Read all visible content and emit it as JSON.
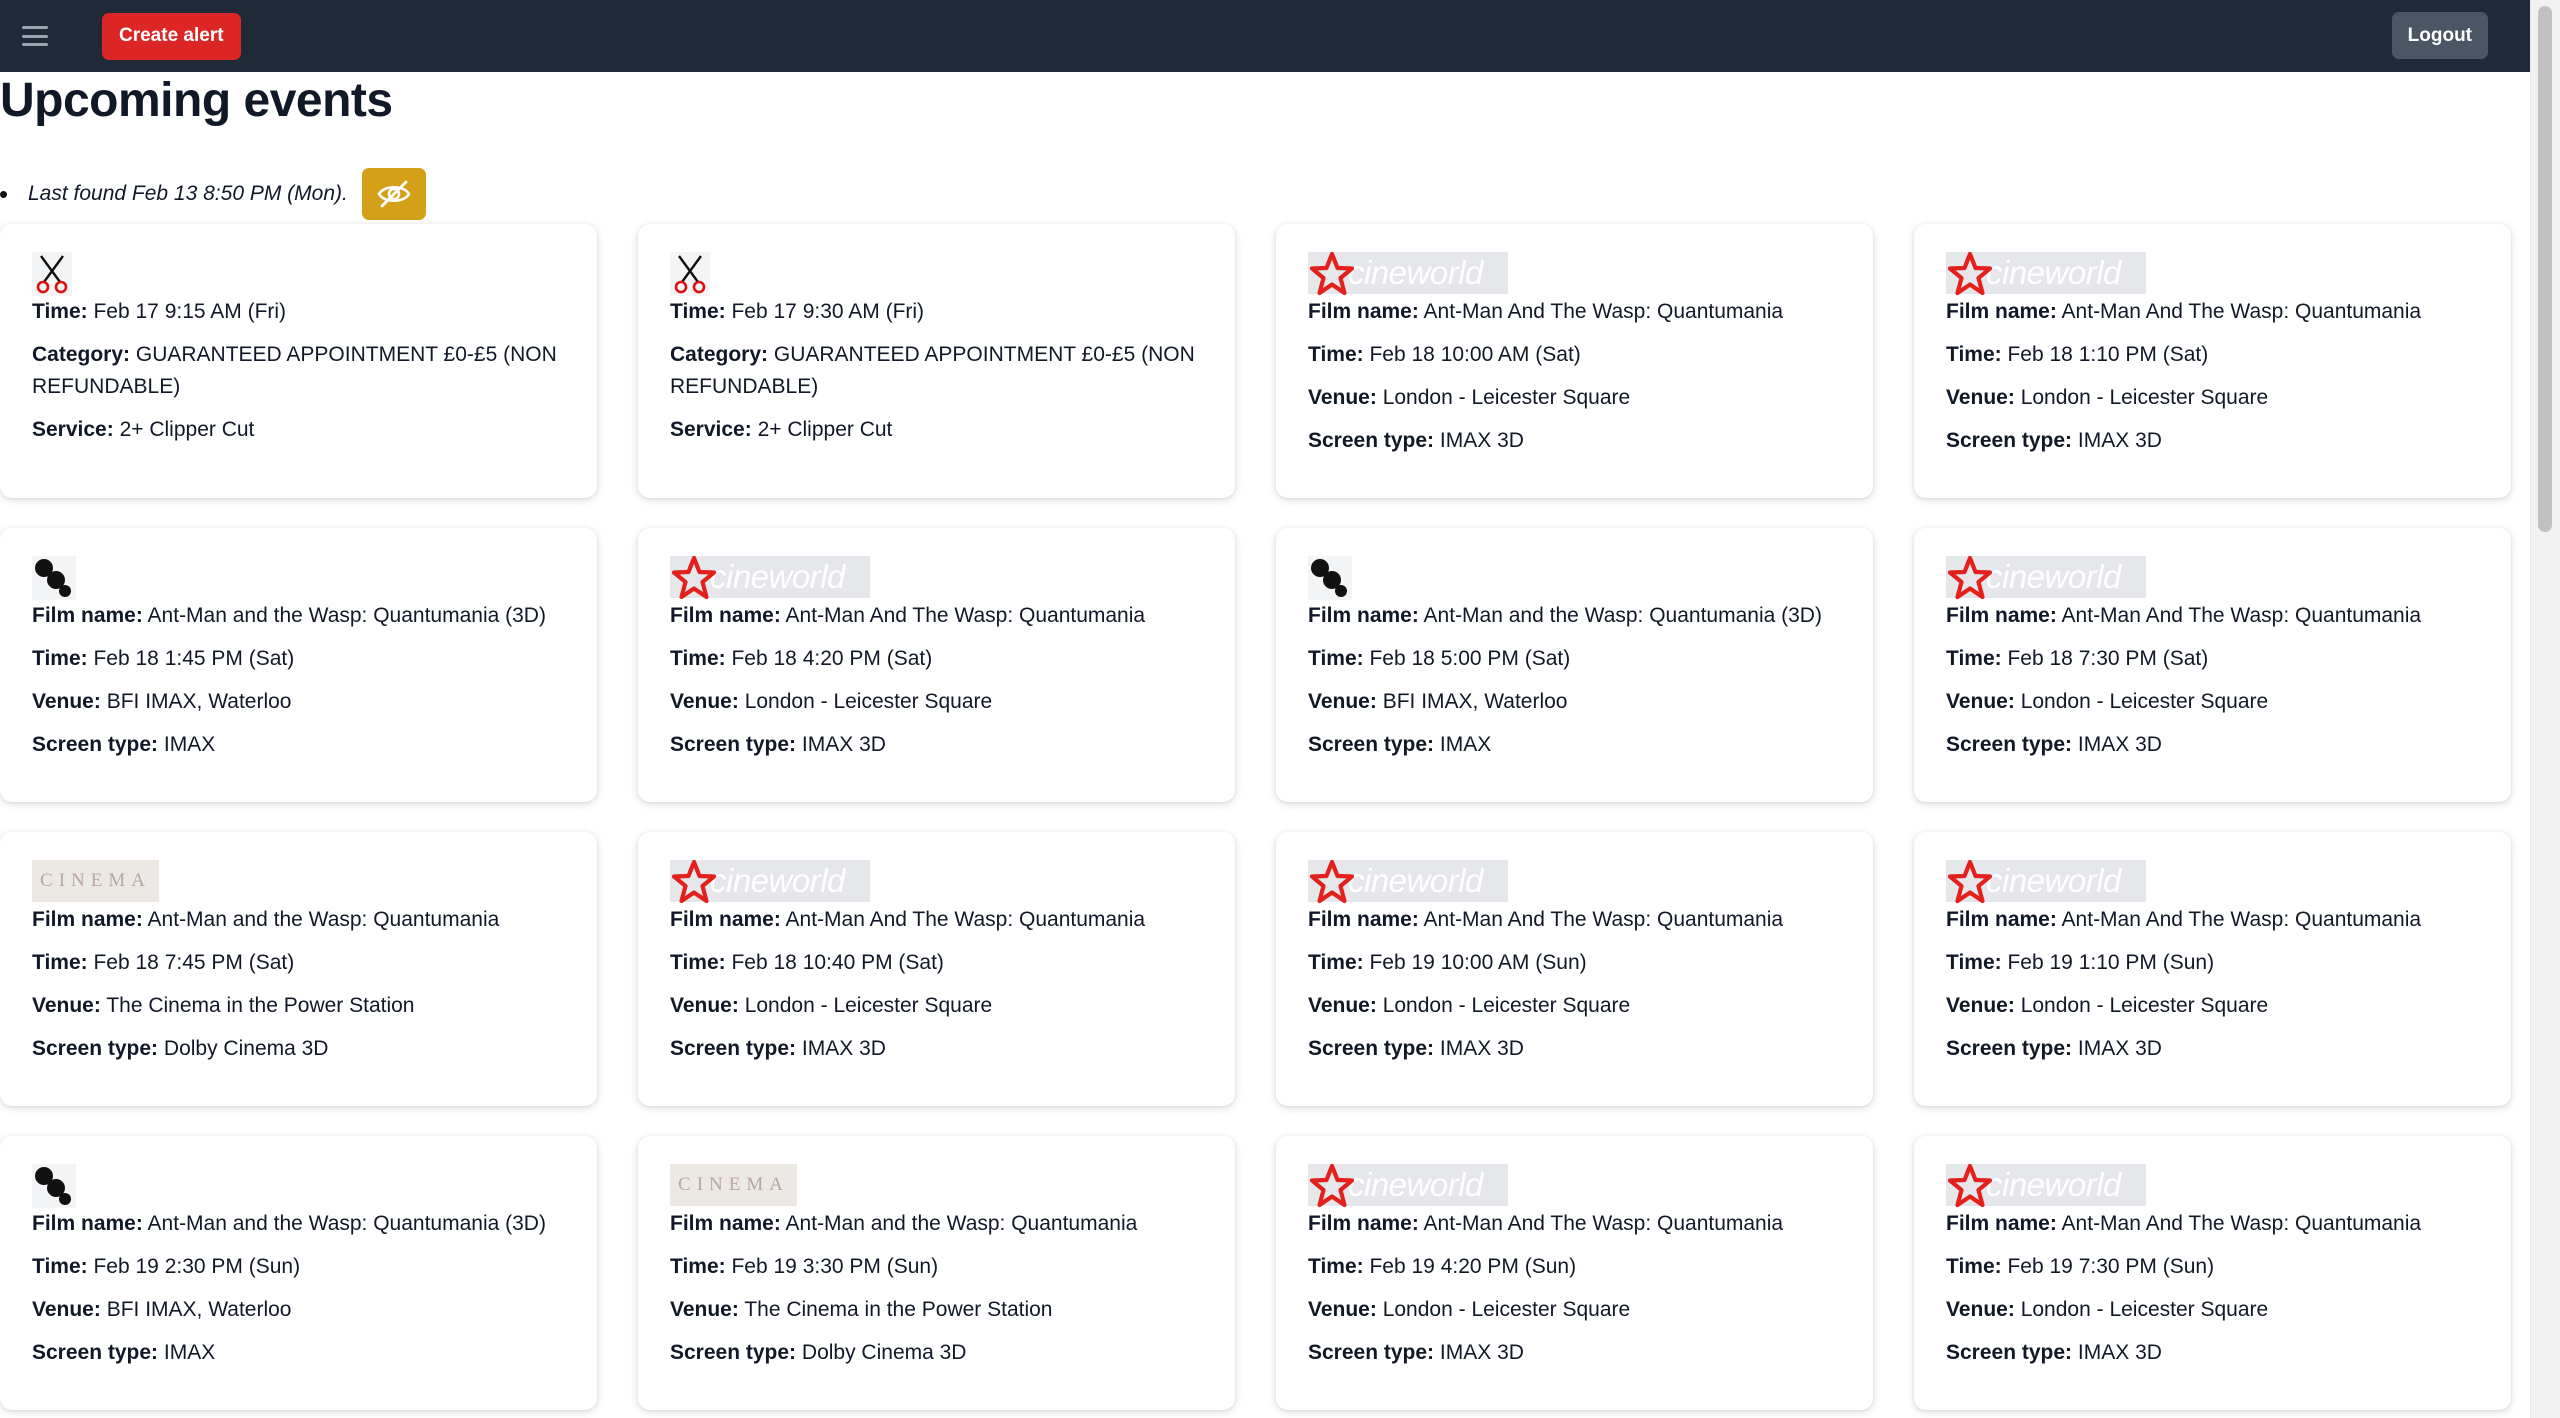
{
  "header": {
    "create_alert_label": "Create alert",
    "logout_label": "Logout"
  },
  "page": {
    "title": "Upcoming events",
    "status": "Last found Feb 13 8:50 PM (Mon)."
  },
  "colors": {
    "topbar": "#1f2937",
    "create_alert": "#dc2626",
    "logout": "#4b5563",
    "hide_toggle": "#d4a017",
    "cineworld_star": "#e3211c"
  },
  "logo_text": {
    "cineworld": "cineworld",
    "cinema": "CINEMA"
  },
  "events": [
    {
      "logo": "scissors-icon",
      "fields": [
        {
          "label": "Time:",
          "value": "Feb 17 9:15 AM (Fri)"
        },
        {
          "label": "Category:",
          "value": "GUARANTEED APPOINTMENT £0-£5 (NON REFUNDABLE)"
        },
        {
          "label": "Service:",
          "value": "2+ Clipper Cut"
        }
      ]
    },
    {
      "logo": "scissors-icon",
      "fields": [
        {
          "label": "Time:",
          "value": "Feb 17 9:30 AM (Fri)"
        },
        {
          "label": "Category:",
          "value": "GUARANTEED APPOINTMENT £0-£5 (NON REFUNDABLE)"
        },
        {
          "label": "Service:",
          "value": "2+ Clipper Cut"
        }
      ]
    },
    {
      "logo": "cineworld-logo",
      "fields": [
        {
          "label": "Film name:",
          "value": "Ant-Man And The Wasp: Quantumania"
        },
        {
          "label": "Time:",
          "value": "Feb 18 10:00 AM (Sat)"
        },
        {
          "label": "Venue:",
          "value": "London - Leicester Square"
        },
        {
          "label": "Screen type:",
          "value": "IMAX 3D"
        }
      ]
    },
    {
      "logo": "cineworld-logo",
      "fields": [
        {
          "label": "Film name:",
          "value": "Ant-Man And The Wasp: Quantumania"
        },
        {
          "label": "Time:",
          "value": "Feb 18 1:10 PM (Sat)"
        },
        {
          "label": "Venue:",
          "value": "London - Leicester Square"
        },
        {
          "label": "Screen type:",
          "value": "IMAX 3D"
        }
      ]
    },
    {
      "logo": "bfi-logo",
      "fields": [
        {
          "label": "Film name:",
          "value": "Ant-Man and the Wasp: Quantumania (3D)"
        },
        {
          "label": "Time:",
          "value": "Feb 18 1:45 PM (Sat)"
        },
        {
          "label": "Venue:",
          "value": "BFI IMAX, Waterloo"
        },
        {
          "label": "Screen type:",
          "value": "IMAX"
        }
      ]
    },
    {
      "logo": "cineworld-logo",
      "fields": [
        {
          "label": "Film name:",
          "value": "Ant-Man And The Wasp: Quantumania"
        },
        {
          "label": "Time:",
          "value": "Feb 18 4:20 PM (Sat)"
        },
        {
          "label": "Venue:",
          "value": "London - Leicester Square"
        },
        {
          "label": "Screen type:",
          "value": "IMAX 3D"
        }
      ]
    },
    {
      "logo": "bfi-logo",
      "fields": [
        {
          "label": "Film name:",
          "value": "Ant-Man and the Wasp: Quantumania (3D)"
        },
        {
          "label": "Time:",
          "value": "Feb 18 5:00 PM (Sat)"
        },
        {
          "label": "Venue:",
          "value": "BFI IMAX, Waterloo"
        },
        {
          "label": "Screen type:",
          "value": "IMAX"
        }
      ]
    },
    {
      "logo": "cineworld-logo",
      "fields": [
        {
          "label": "Film name:",
          "value": "Ant-Man And The Wasp: Quantumania"
        },
        {
          "label": "Time:",
          "value": "Feb 18 7:30 PM (Sat)"
        },
        {
          "label": "Venue:",
          "value": "London - Leicester Square"
        },
        {
          "label": "Screen type:",
          "value": "IMAX 3D"
        }
      ]
    },
    {
      "logo": "cinema-logo",
      "fields": [
        {
          "label": "Film name:",
          "value": "Ant-Man and the Wasp: Quantumania"
        },
        {
          "label": "Time:",
          "value": "Feb 18 7:45 PM (Sat)"
        },
        {
          "label": "Venue:",
          "value": "The Cinema in the Power Station"
        },
        {
          "label": "Screen type:",
          "value": "Dolby Cinema 3D"
        }
      ]
    },
    {
      "logo": "cineworld-logo",
      "fields": [
        {
          "label": "Film name:",
          "value": "Ant-Man And The Wasp: Quantumania"
        },
        {
          "label": "Time:",
          "value": "Feb 18 10:40 PM (Sat)"
        },
        {
          "label": "Venue:",
          "value": "London - Leicester Square"
        },
        {
          "label": "Screen type:",
          "value": "IMAX 3D"
        }
      ]
    },
    {
      "logo": "cineworld-logo",
      "fields": [
        {
          "label": "Film name:",
          "value": "Ant-Man And The Wasp: Quantumania"
        },
        {
          "label": "Time:",
          "value": "Feb 19 10:00 AM (Sun)"
        },
        {
          "label": "Venue:",
          "value": "London - Leicester Square"
        },
        {
          "label": "Screen type:",
          "value": "IMAX 3D"
        }
      ]
    },
    {
      "logo": "cineworld-logo",
      "fields": [
        {
          "label": "Film name:",
          "value": "Ant-Man And The Wasp: Quantumania"
        },
        {
          "label": "Time:",
          "value": "Feb 19 1:10 PM (Sun)"
        },
        {
          "label": "Venue:",
          "value": "London - Leicester Square"
        },
        {
          "label": "Screen type:",
          "value": "IMAX 3D"
        }
      ]
    },
    {
      "logo": "bfi-logo",
      "fields": [
        {
          "label": "Film name:",
          "value": "Ant-Man and the Wasp: Quantumania (3D)"
        },
        {
          "label": "Time:",
          "value": "Feb 19 2:30 PM (Sun)"
        },
        {
          "label": "Venue:",
          "value": "BFI IMAX, Waterloo"
        },
        {
          "label": "Screen type:",
          "value": "IMAX"
        }
      ]
    },
    {
      "logo": "cinema-logo",
      "fields": [
        {
          "label": "Film name:",
          "value": "Ant-Man and the Wasp: Quantumania"
        },
        {
          "label": "Time:",
          "value": "Feb 19 3:30 PM (Sun)"
        },
        {
          "label": "Venue:",
          "value": "The Cinema in the Power Station"
        },
        {
          "label": "Screen type:",
          "value": "Dolby Cinema 3D"
        }
      ]
    },
    {
      "logo": "cineworld-logo",
      "fields": [
        {
          "label": "Film name:",
          "value": "Ant-Man And The Wasp: Quantumania"
        },
        {
          "label": "Time:",
          "value": "Feb 19 4:20 PM (Sun)"
        },
        {
          "label": "Venue:",
          "value": "London - Leicester Square"
        },
        {
          "label": "Screen type:",
          "value": "IMAX 3D"
        }
      ]
    },
    {
      "logo": "cineworld-logo",
      "fields": [
        {
          "label": "Film name:",
          "value": "Ant-Man And The Wasp: Quantumania"
        },
        {
          "label": "Time:",
          "value": "Feb 19 7:30 PM (Sun)"
        },
        {
          "label": "Venue:",
          "value": "London - Leicester Square"
        },
        {
          "label": "Screen type:",
          "value": "IMAX 3D"
        }
      ]
    }
  ]
}
